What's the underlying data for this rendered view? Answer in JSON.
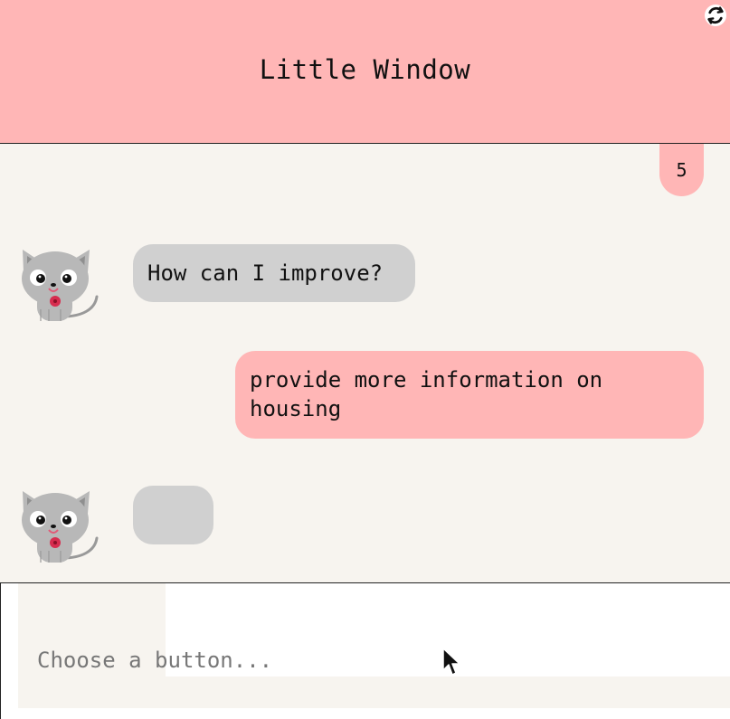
{
  "window": {
    "title": "Little Window",
    "refresh_icon": "refresh-icon"
  },
  "chat": {
    "message_count": "5",
    "messages": [
      {
        "role": "bot",
        "text": "How can I improve?"
      },
      {
        "role": "user",
        "text": "provide more information on housing"
      },
      {
        "role": "bot",
        "text": ""
      }
    ]
  },
  "footer": {
    "placeholder": "Choose a button..."
  },
  "colors": {
    "header": "#ffb6b6",
    "chat_background": "#f7f4ef",
    "bot_bubble": "#d0d0d0",
    "user_bubble": "#ffb6b6",
    "text": "#111111",
    "placeholder": "#777777"
  },
  "icons": {
    "avatar": "cat-avatar-icon",
    "cursor": "mouse-pointer-icon"
  }
}
